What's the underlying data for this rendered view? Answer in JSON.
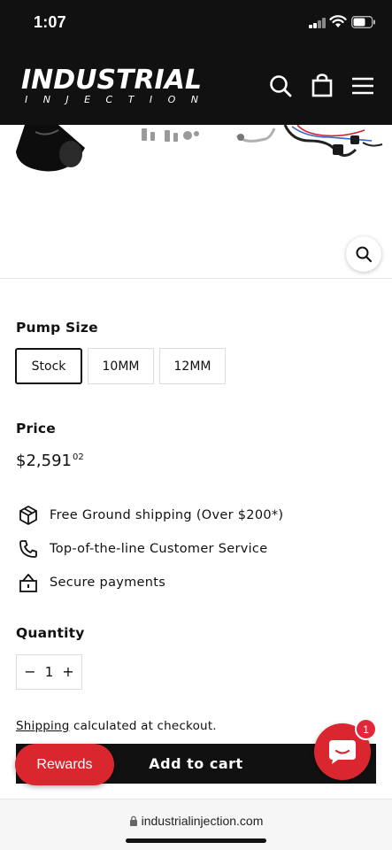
{
  "status": {
    "time": "1:07"
  },
  "header": {
    "logo_text": "INDUSTRIAL",
    "logo_subtext": "INJECTION",
    "icons": [
      "search-icon",
      "cart-bag-icon",
      "menu-icon"
    ]
  },
  "gallery": {
    "zoom_icon": "zoom-icon"
  },
  "pump_size": {
    "label": "Pump Size",
    "options": [
      "Stock",
      "10MM",
      "12MM"
    ],
    "selected": "Stock"
  },
  "price": {
    "label": "Price",
    "whole": "$2,591",
    "cents": "02"
  },
  "features": [
    {
      "icon": "package-icon",
      "text": "Free Ground shipping (Over $200*)"
    },
    {
      "icon": "phone-icon",
      "text": "Top-of-the-line Customer Service"
    },
    {
      "icon": "lock-icon",
      "text": "Secure payments"
    }
  ],
  "quantity": {
    "label": "Quantity",
    "value": "1",
    "minus": "−",
    "plus": "+"
  },
  "shipping_note": {
    "link": "Shipping",
    "rest": " calculated at checkout."
  },
  "add_to_cart": {
    "label": "Add to cart"
  },
  "rewards": {
    "label": "Rewards"
  },
  "chat": {
    "badge": "1"
  },
  "browser": {
    "url": "industrialinjection.com"
  },
  "colors": {
    "header_bg": "#111111",
    "accent_red": "#d9262f"
  }
}
